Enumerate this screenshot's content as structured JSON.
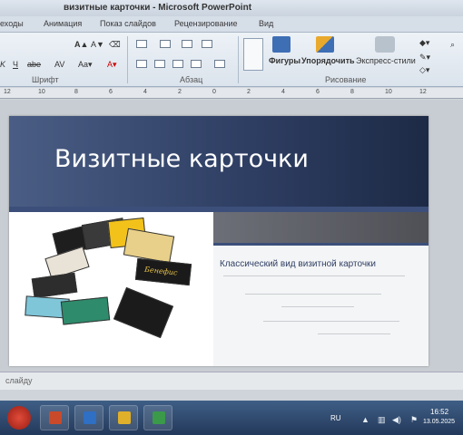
{
  "window": {
    "title": "визитные карточки - Microsoft PowerPoint"
  },
  "tabs": [
    "еходы",
    "Анимация",
    "Показ слайдов",
    "Рецензирование",
    "Вид"
  ],
  "ribbon": {
    "groups": {
      "font": "Шрифт",
      "paragraph": "Абзац",
      "drawing": "Рисование"
    },
    "buttons": {
      "shapes": "Фигуры",
      "arrange": "Упорядочить",
      "quick_styles": "Экспресс-стили"
    }
  },
  "ruler": [
    "12",
    "10",
    "8",
    "6",
    "4",
    "2",
    "0",
    "2",
    "4",
    "6",
    "8",
    "10",
    "12"
  ],
  "slide": {
    "title": "Визитные карточки",
    "subtitle": "Классический вид визитной карточки",
    "card_label": "Бенефис"
  },
  "notes": {
    "placeholder": "слайду"
  },
  "taskbar": {
    "lang": "RU",
    "time": "16:52",
    "date": "13.05.2025"
  },
  "colors": {
    "header": "#2f3f64",
    "accent": "#3c4f7a",
    "title_text": "#ffffff"
  }
}
